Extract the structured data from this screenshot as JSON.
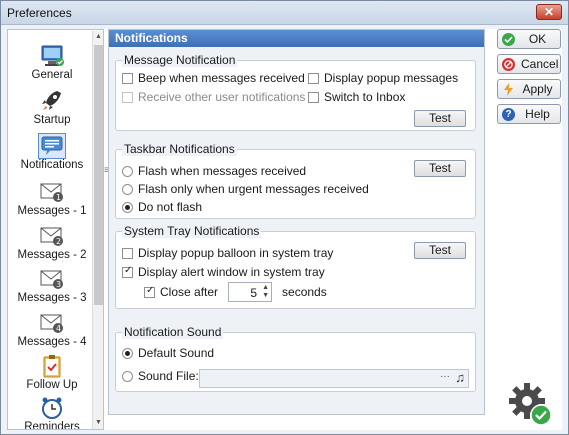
{
  "window": {
    "title": "Preferences",
    "close_glyph": "✕"
  },
  "nav": {
    "items": [
      {
        "label": "General",
        "icon": "monitor-icon"
      },
      {
        "label": "Startup",
        "icon": "rocket-icon"
      },
      {
        "label": "Notifications",
        "icon": "speech-bubble-icon",
        "selected": true
      },
      {
        "label": "Messages - 1",
        "icon": "envelope-1-icon"
      },
      {
        "label": "Messages - 2",
        "icon": "envelope-2-icon"
      },
      {
        "label": "Messages - 3",
        "icon": "envelope-3-icon"
      },
      {
        "label": "Messages - 4",
        "icon": "envelope-4-icon"
      },
      {
        "label": "Follow Up",
        "icon": "clipboard-check-icon"
      },
      {
        "label": "Reminders",
        "icon": "alarm-clock-icon"
      }
    ]
  },
  "panel": {
    "title": "Notifications",
    "message_notification": {
      "legend": "Message Notification",
      "beep": "Beep when messages received",
      "receive_other": "Receive other user notifications",
      "popup": "Display popup messages",
      "switch_inbox": "Switch to Inbox",
      "test": "Test"
    },
    "taskbar": {
      "legend": "Taskbar Notifications",
      "flash": "Flash when messages received",
      "flash_urgent": "Flash only when urgent messages received",
      "no_flash": "Do not flash",
      "test": "Test"
    },
    "tray": {
      "legend": "System Tray Notifications",
      "balloon": "Display popup balloon in system tray",
      "alert": "Display alert window in system tray",
      "close_after": "Close after",
      "close_value": "5",
      "seconds": "seconds",
      "test": "Test"
    },
    "sound": {
      "legend": "Notification Sound",
      "default": "Default Sound",
      "file": "Sound File:",
      "browse": "···",
      "note": "♫"
    }
  },
  "buttons": {
    "ok": "OK",
    "cancel": "Cancel",
    "apply": "Apply",
    "help": "Help"
  },
  "colors": {
    "header": "#4a7fc8",
    "ok_icon": "#3aa84a",
    "cancel_icon": "#d2322d",
    "apply_icon": "#f0a020",
    "help_icon": "#2b62b5"
  }
}
